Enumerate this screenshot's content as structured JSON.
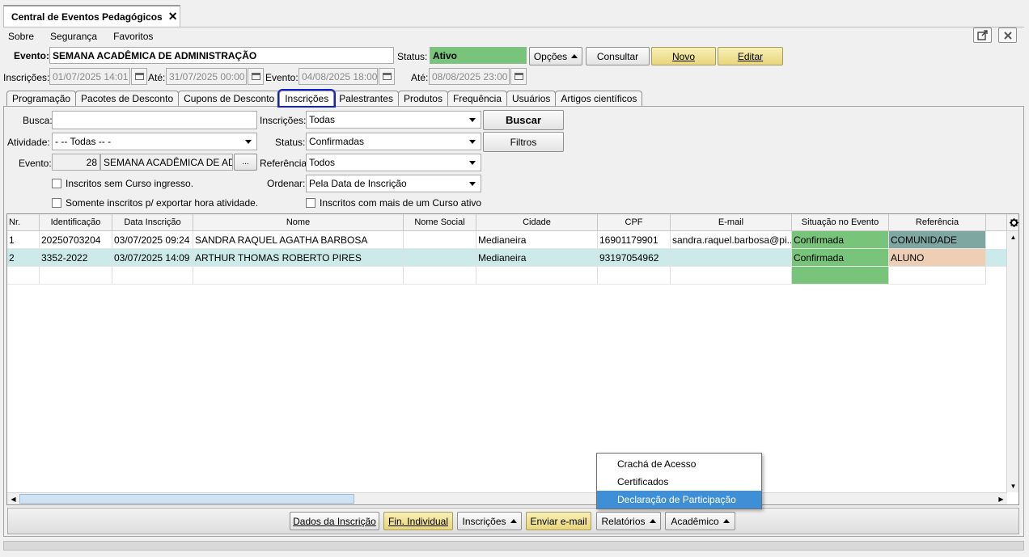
{
  "window": {
    "title": "Central de Eventos Pedagógicos",
    "close_glyph": "✕"
  },
  "menu": [
    "Sobre",
    "Segurança",
    "Favoritos"
  ],
  "header": {
    "evento_label": "Evento:",
    "evento_value": "SEMANA ACADÊMICA DE ADMINISTRAÇÃO",
    "status_label": "Status:",
    "status_value": "Ativo",
    "opcoes": "Opções",
    "consultar": "Consultar",
    "novo": "Novo",
    "editar": "Editar",
    "inscricoes_label": "Inscrições:",
    "inscricoes_inicio": "01/07/2025 14:01",
    "ate_label": "Até:",
    "inscricoes_fim": "31/07/2025 00:00",
    "evento2_label": "Evento:",
    "evento_inicio": "04/08/2025 18:00",
    "ate2_label": "Até:",
    "evento_fim": "08/08/2025 23:00"
  },
  "tabs": [
    "Programação",
    "Pacotes de Desconto",
    "Cupons de Desconto",
    "Inscrições",
    "Palestrantes",
    "Produtos",
    "Frequência",
    "Usuários",
    "Artigos científicos"
  ],
  "filters": {
    "busca_label": "Busca:",
    "busca_value": "",
    "inscricoes_label": "Inscrições:",
    "inscricoes_value": "Todas",
    "buscar": "Buscar",
    "atividade_label": "Atividade:",
    "atividade_value": "- -- Todas -- -",
    "status_label": "Status:",
    "status_value": "Confirmadas",
    "filtros": "Filtros",
    "evento_label": "Evento:",
    "evento_id": "28",
    "evento_nome": "SEMANA ACADÊMICA DE ADM",
    "ellipsis": "...",
    "referencia_label": "Referência",
    "referencia_value": "Todos",
    "ordenar_label": "Ordenar:",
    "ordenar_value": "Pela Data de Inscrição",
    "chk_sem_curso": "Inscritos sem Curso ingresso.",
    "chk_exportar": "Somente inscritos p/ exportar hora atividade.",
    "chk_mais_curso": "Inscritos com mais de um Curso ativo"
  },
  "table": {
    "headers": [
      "Nr.",
      "Identificação",
      "Data Inscrição",
      "Nome",
      "Nome Social",
      "Cidade",
      "CPF",
      "E-mail",
      "Situação no Evento",
      "Referência"
    ],
    "rows": [
      [
        "1",
        "20250703204",
        "03/07/2025 09:24",
        "SANDRA RAQUEL AGATHA BARBOSA",
        "",
        "Medianeira",
        "16901179901",
        "sandra.raquel.barbosa@pi...",
        "Confirmada",
        "COMUNIDADE"
      ],
      [
        "2",
        "3352-2022",
        "03/07/2025 14:09",
        "ARTHUR THOMAS ROBERTO PIRES",
        "",
        "Medianeira",
        "93197054962",
        "",
        "Confirmada",
        "ALUNO"
      ]
    ]
  },
  "footer": {
    "dados": "Dados da Inscrição",
    "fin": "Fin. Individual",
    "inscricoes": "Inscrições",
    "email": "Enviar e-mail",
    "relatorios": "Relatórios",
    "academico": "Acadêmico"
  },
  "popup": [
    "Crachá de Acesso",
    "Certificados",
    "Declaração de Participação"
  ],
  "colors": {
    "active_tab_outline": "#1221c9",
    "status_green": "#77c47a",
    "highlight": "#3f8fd6"
  }
}
